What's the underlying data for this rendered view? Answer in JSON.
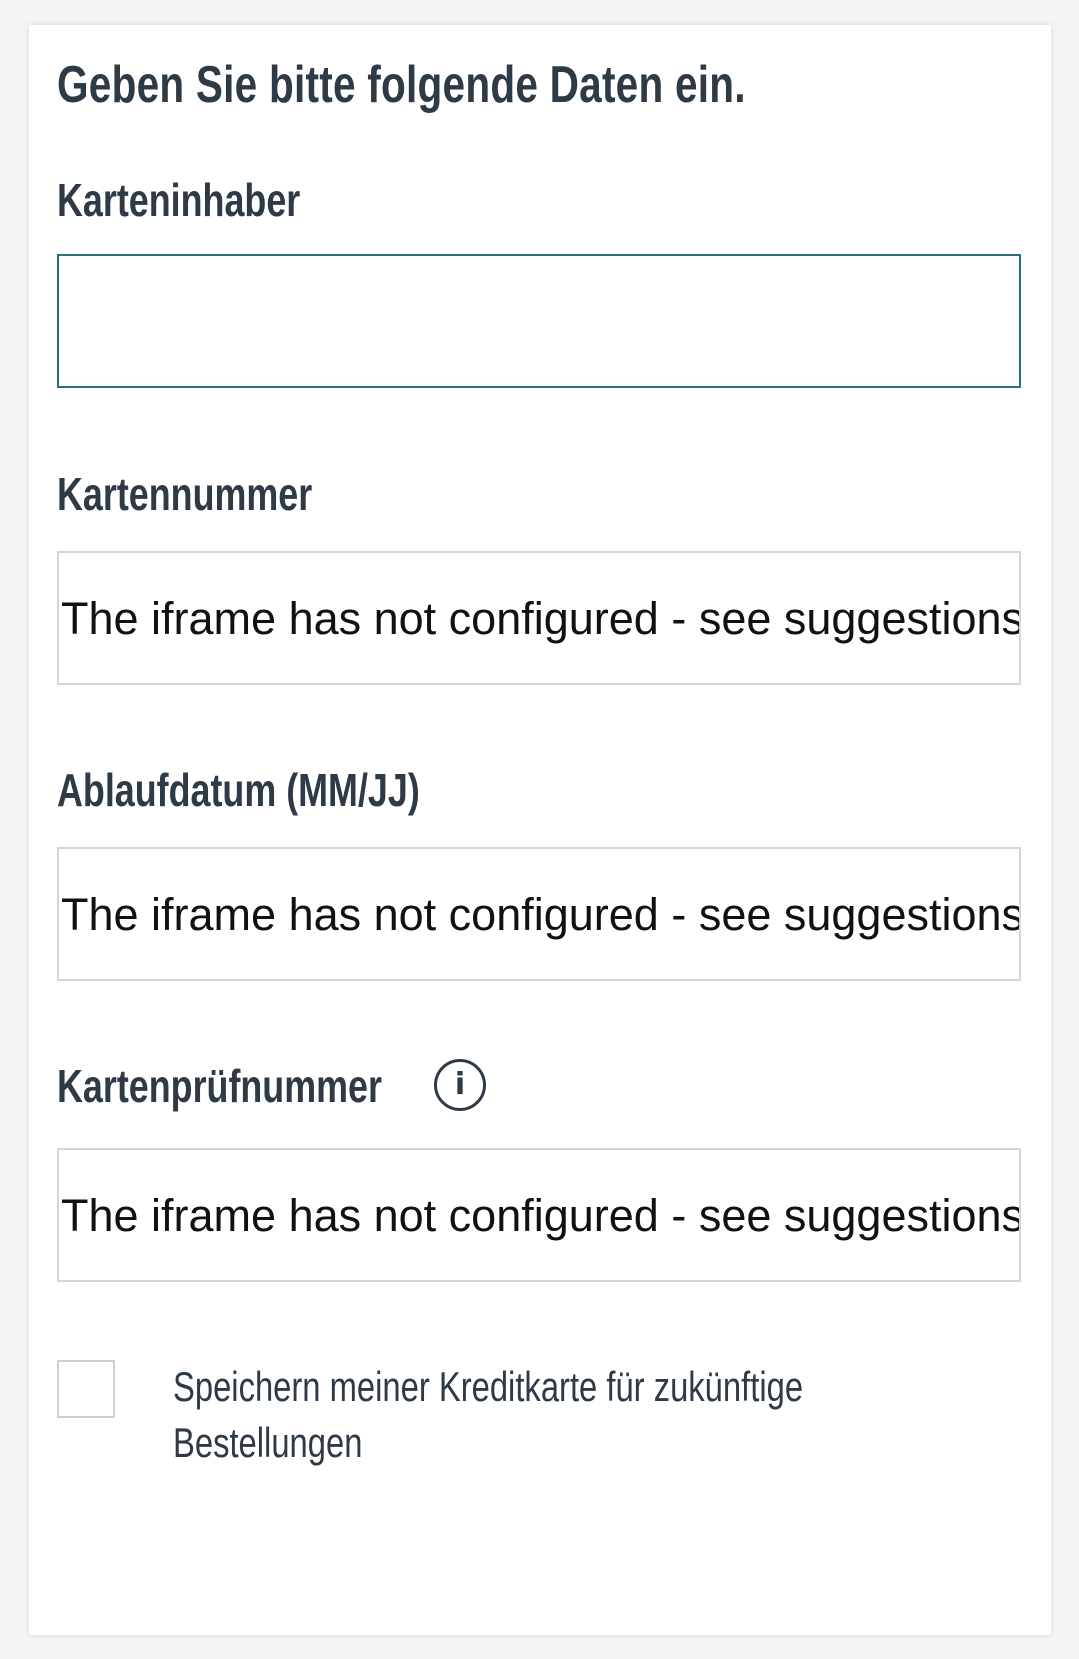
{
  "form": {
    "heading": "Geben Sie bitte folgende Daten ein.",
    "cardholder": {
      "label": "Karteninhaber",
      "value": "",
      "placeholder": ""
    },
    "card_number": {
      "label": "Kartennummer",
      "frame_message": "The iframe has not configured - see suggestions"
    },
    "expiry": {
      "label": "Ablaufdatum (MM/JJ)",
      "frame_message": "The iframe has not configured - see suggestions"
    },
    "cvc": {
      "label": "Kartenprüfnummer",
      "info_icon": "info-icon",
      "info_glyph": "i",
      "frame_message": "The iframe has not configured - see suggestions"
    },
    "save_card": {
      "checked": false,
      "label_line1": "Speichern meiner Kreditkarte für zukünftige",
      "label_line2": "Bestellungen"
    }
  },
  "colors": {
    "text": "#2e3a46",
    "focus_border": "#2b6f7e",
    "frame_border": "#d6d6d6",
    "background": "#f5f5f5"
  }
}
